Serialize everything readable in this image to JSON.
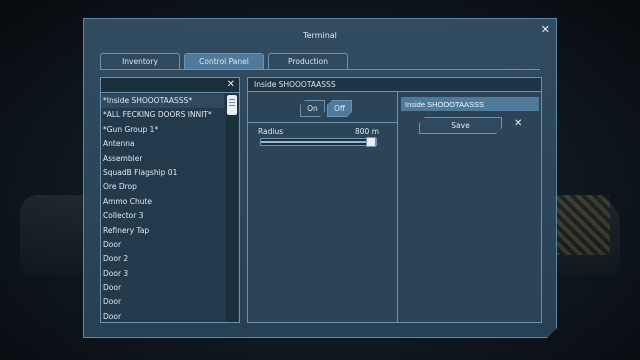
{
  "window": {
    "title": "Terminal",
    "close_glyph": "✕"
  },
  "tabs": [
    {
      "label": "Inventory",
      "active": false
    },
    {
      "label": "Control Panel",
      "active": true
    },
    {
      "label": "Production",
      "active": false
    }
  ],
  "block_list": {
    "search_value": "",
    "clear_glyph": "✕",
    "items": [
      "*Inside SHOOOTAASSS*",
      "*ALL FECKING DOORS INNIT*",
      "*Gun Group 1*",
      "Antenna",
      "Assembler",
      "SquadB Flagship 01",
      "Ore Drop",
      "Ammo Chute",
      "Collector 3",
      "Refinery Tap",
      "Door",
      "Door 2",
      "Door 3",
      "Door",
      "Door",
      "Door"
    ],
    "selected_index": 0,
    "scroll_position": 0.0
  },
  "detail": {
    "header": "Inside SHOOOTAASSS",
    "on_label": "On",
    "off_label": "Off",
    "power_state": "Off",
    "radius_label": "Radius",
    "radius_value": "800 m",
    "radius_fraction": 1.0,
    "name_value": "Inside SHOOOTAASSS",
    "save_label": "Save",
    "cancel_glyph": "✕"
  },
  "colors": {
    "accent": "#4f7a99",
    "panel": "#2b4457",
    "border": "#6b93b1"
  }
}
